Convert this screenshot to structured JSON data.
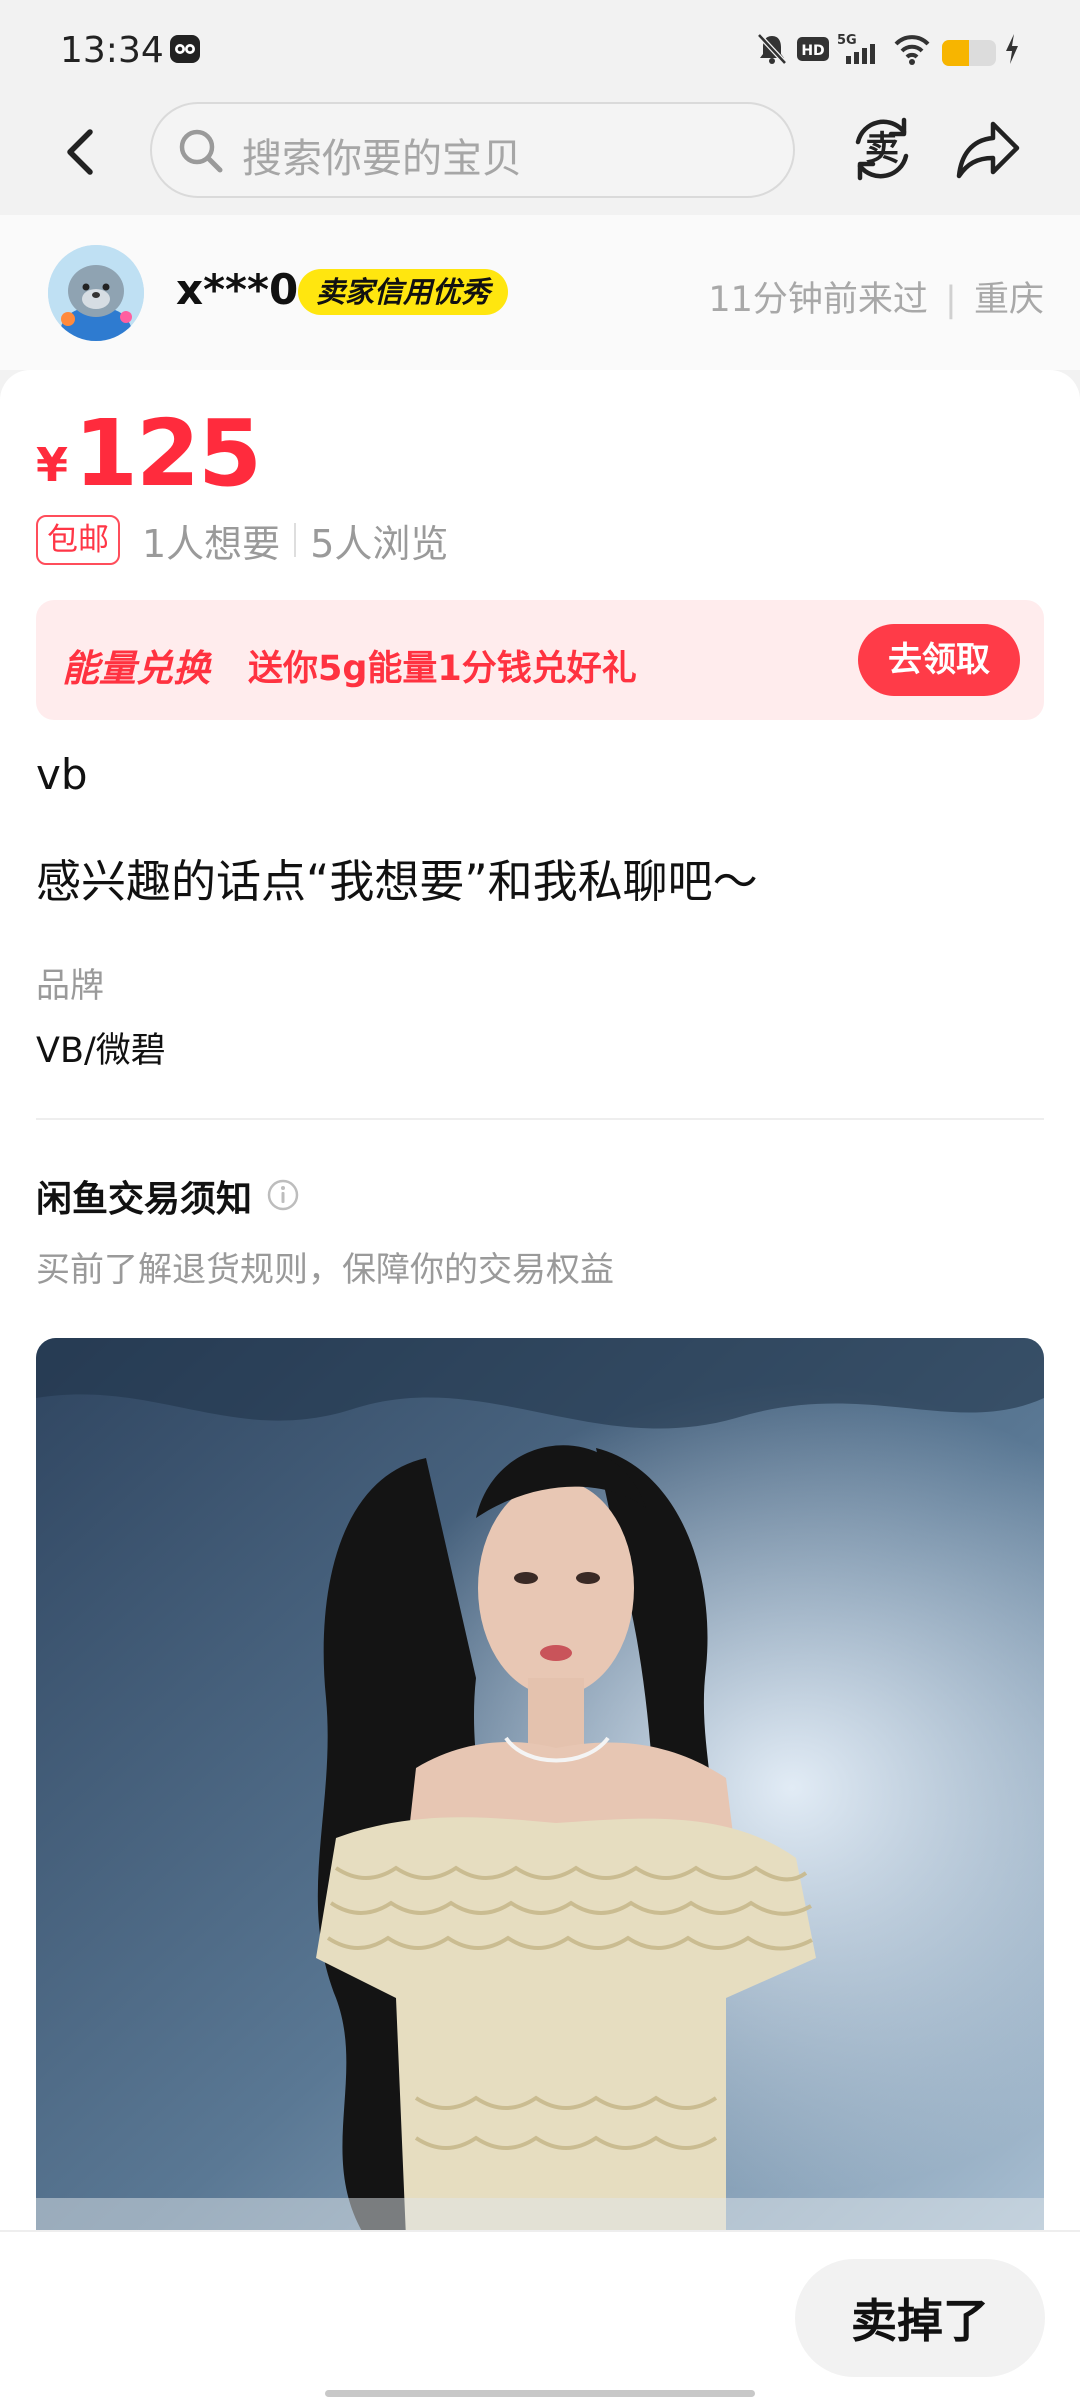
{
  "status_bar": {
    "time": "13:34",
    "icons": [
      "app-notification-icon",
      "mute-bell-icon",
      "hd-icon",
      "5g-signal-icon",
      "wifi-icon",
      "battery-icon",
      "charging-icon"
    ],
    "hd_label": "HD",
    "network_label": "5G",
    "battery_level": 0.5
  },
  "nav": {
    "search_placeholder": "搜索你要的宝贝",
    "sell_label": "卖",
    "icons": [
      "back-icon",
      "search-icon",
      "sell-exchange-icon",
      "share-icon"
    ]
  },
  "seller": {
    "name": "x***0",
    "badge": "卖家信用优秀",
    "last_seen": "11分钟前来过",
    "separator": "|",
    "location": "重庆"
  },
  "item": {
    "currency": "¥",
    "price": "125",
    "free_shipping": "包邮",
    "wants": "1人想要",
    "views": "5人浏览",
    "title": "vb",
    "description": "感兴趣的话点“我想要”和我私聊吧～",
    "brand_label": "品牌",
    "brand_value": "VB/微碧"
  },
  "energy_banner": {
    "title": "能量兑换",
    "text": "送你5g能量1分钱兑好礼",
    "button": "去领取"
  },
  "notice": {
    "title": "闲鱼交易须知",
    "subtitle": "买前了解退货规则，保障你的交易权益"
  },
  "bottom_bar": {
    "sold_button": "卖掉了"
  },
  "colors": {
    "price_red": "#ff2b3d",
    "badge_yellow": "#ffe60f",
    "banner_bg": "#ffeced",
    "banner_button": "#ff3b48",
    "page_bg": "#f2f2f2"
  }
}
